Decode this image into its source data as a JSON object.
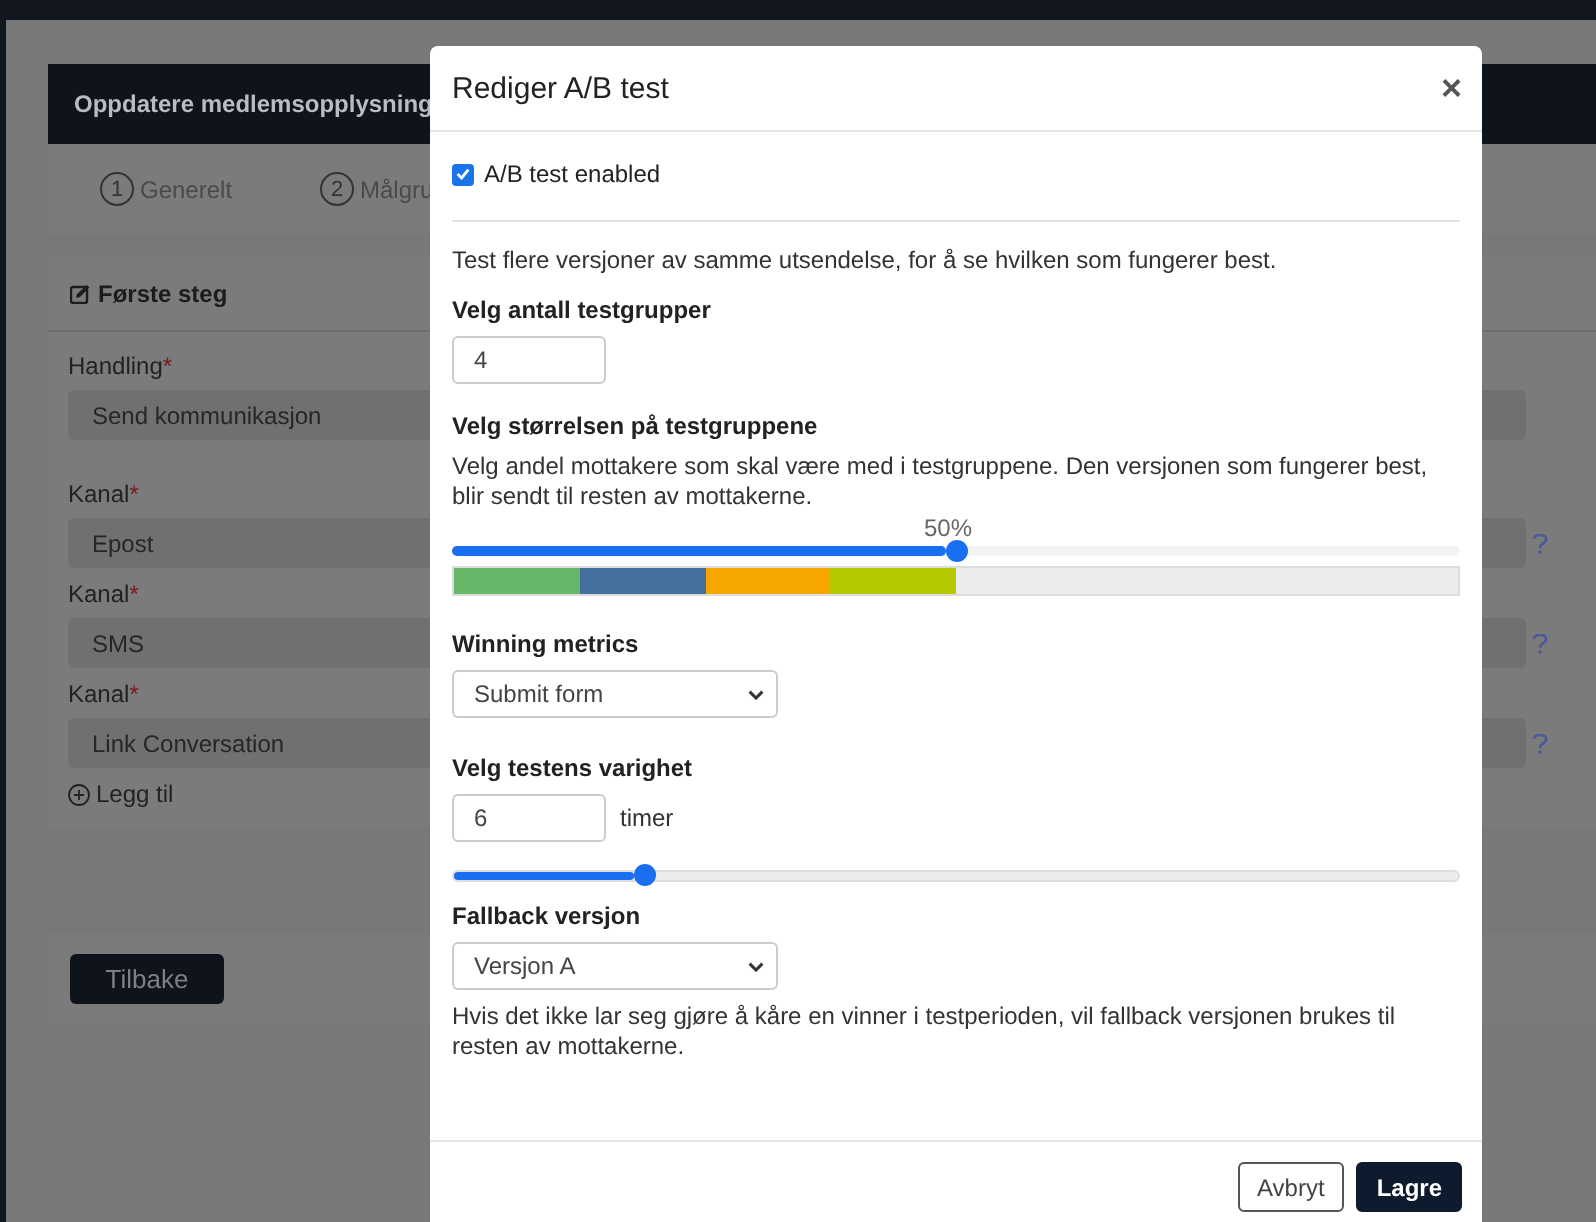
{
  "page": {
    "title": "Oppdatere medlemsopplysning",
    "steps": [
      {
        "number": "1",
        "label": "Generelt"
      },
      {
        "number": "2",
        "label": "Målgru"
      }
    ],
    "section": {
      "title": "Første steg",
      "fields": [
        {
          "label": "Handling",
          "mark": "*",
          "value": "Send kommunikasjon",
          "help": false
        },
        {
          "label": "Kanal",
          "mark": "*",
          "value": "Epost",
          "help": true
        },
        {
          "label": "Kanal",
          "mark": "*",
          "value": "SMS",
          "help": true
        },
        {
          "label": "Kanal",
          "mark": "*",
          "value": "Link Conversation",
          "help": true
        }
      ],
      "add_label": "Legg til"
    },
    "back_button": "Tilbake"
  },
  "dialog": {
    "title": "Rediger A/B test",
    "close": "×",
    "enabled": {
      "label": "A/B test enabled",
      "checked": true
    },
    "intro": "Test flere versjoner av samme utsendelse, for å se hvilken som fungerer best.",
    "group_count": {
      "label": "Velg antall testgrupper",
      "value": "4"
    },
    "group_size": {
      "label": "Velg størrelsen på testgruppene",
      "description": "Velg andel mottakere som skal være med i testgruppene. Den versjonen som fungerer best, blir sendt til resten av mottakerne.",
      "reading": "50%",
      "level": 0.5,
      "groups": [
        {
          "color": "#66b868"
        },
        {
          "color": "#44709e"
        },
        {
          "color": "#f7a600"
        },
        {
          "color": "#b5c800"
        }
      ]
    },
    "metric": {
      "label": "Winning metrics",
      "value": "Submit form"
    },
    "duration": {
      "label": "Velg testens varighet",
      "value": "6",
      "unit": "timer",
      "level": 0.19
    },
    "fallback": {
      "label": "Fallback versjon",
      "value": "Versjon A",
      "note": "Hvis det ikke lar seg gjøre å kåre en vinner i testperioden, vil fallback versjonen brukes til resten av mottakerne."
    },
    "buttons": [
      {
        "label": "Avbryt",
        "kind": "secondary"
      },
      {
        "label": "Lagre",
        "kind": "primary"
      }
    ]
  }
}
